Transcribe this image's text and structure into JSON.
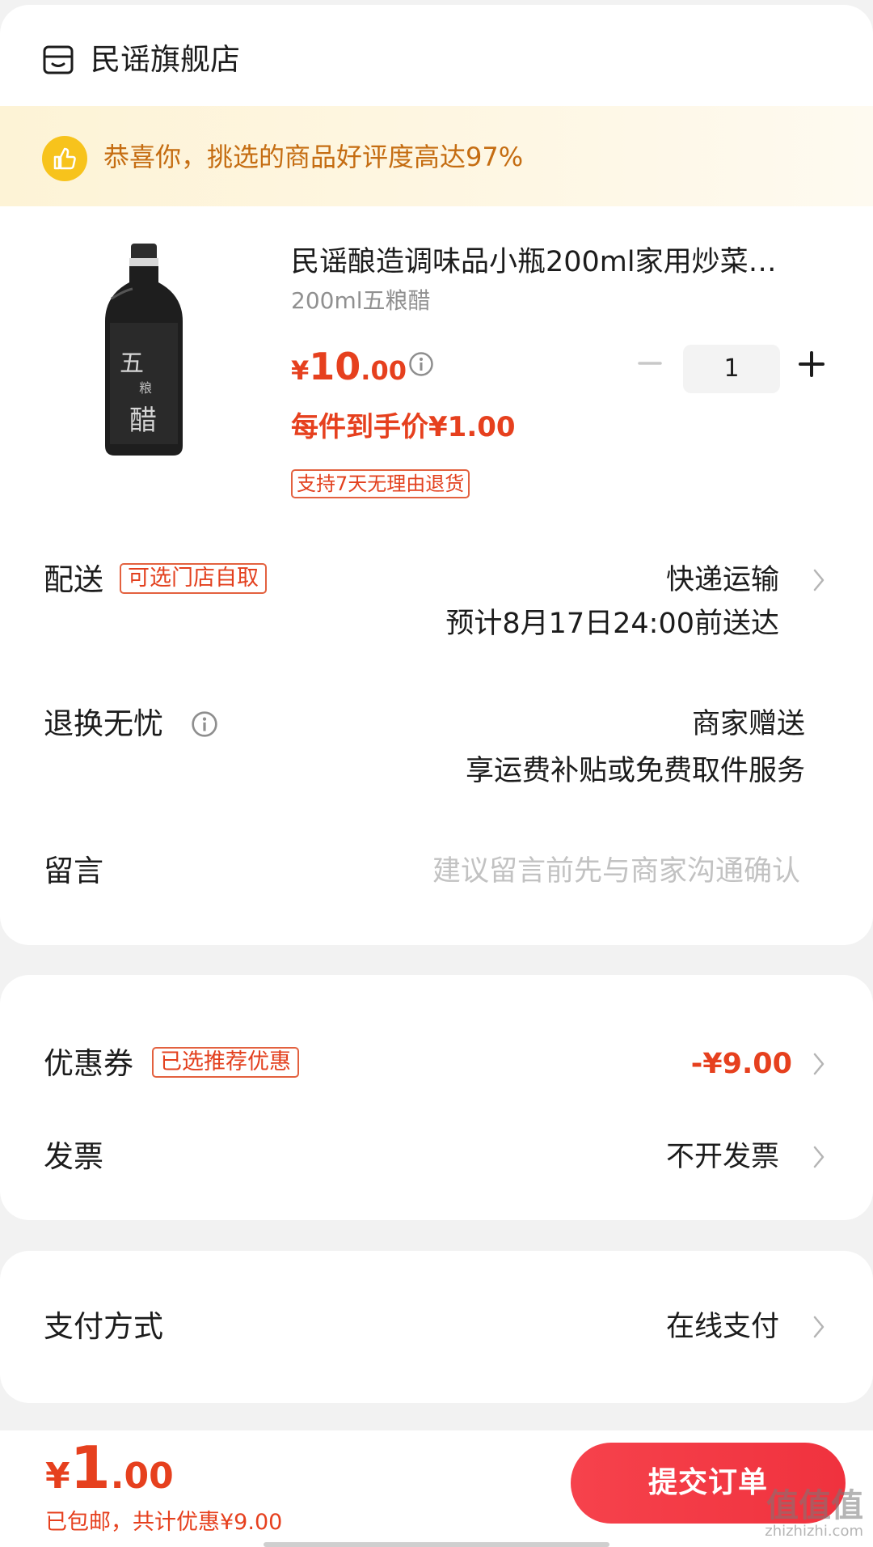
{
  "store": {
    "name": "民谣旗舰店",
    "icon": "store-icon"
  },
  "banner": {
    "text": "恭喜你，挑选的商品好评度高达97%",
    "icon": "thumbs-up-icon"
  },
  "product": {
    "title": "民谣酿造调味品小瓶200ml家用炒菜…",
    "spec": "200ml五粮醋",
    "price_symbol": "¥",
    "price_int": "10",
    "price_dec": ".00",
    "unit_price": "每件到手价¥1.00",
    "return_tag": "支持7天无理由退货",
    "quantity": "1"
  },
  "delivery": {
    "label": "配送",
    "tag": "可选门店自取",
    "method": "快递运输",
    "eta": "预计8月17日24:00前送达"
  },
  "returns": {
    "label": "退换无忧",
    "value": "商家赠送",
    "sub": "享运费补贴或免费取件服务"
  },
  "note": {
    "label": "留言",
    "placeholder": "建议留言前先与商家沟通确认"
  },
  "coupon": {
    "label": "优惠券",
    "tag": "已选推荐优惠",
    "value": "-¥9.00"
  },
  "invoice": {
    "label": "发票",
    "value": "不开发票"
  },
  "payment": {
    "label": "支付方式",
    "value": "在线支付"
  },
  "footer": {
    "total_symbol": "¥",
    "total_int": "1",
    "total_dec": ".00",
    "sub": "已包邮，共计优惠¥9.00",
    "submit": "提交订单",
    "watermark": "值值值",
    "watermark_url": "zhizhizhi.com"
  },
  "colors": {
    "accent": "#e6401e",
    "submit": "#f0323e",
    "banner_text": "#c56d12",
    "badge": "#f7c31c"
  }
}
